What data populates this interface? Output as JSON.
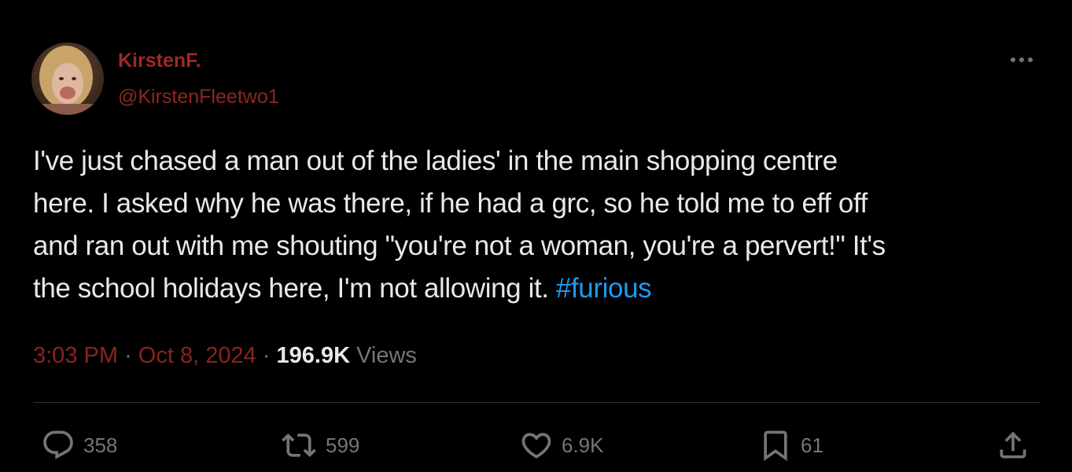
{
  "author": {
    "display_name": "KirstenF.",
    "handle": "@KirstenFleetwo1"
  },
  "tweet": {
    "lines": [
      "I've just chased a man out of the ladies' in the main shopping centre",
      "here. I asked why he was there, if he had a grc, so he told me to eff off",
      "and ran out with me shouting \"you're not a woman, you're a pervert!\" It's",
      "the school holidays here, I'm not allowing it. "
    ],
    "hashtag": "#furious"
  },
  "meta": {
    "time": "3:03 PM",
    "date": "Oct 8, 2024",
    "separator": "·",
    "views_count": "196.9K",
    "views_label": "Views"
  },
  "actions": {
    "replies": "358",
    "reposts": "599",
    "likes": "6.9K",
    "bookmarks": "61"
  },
  "icons": {
    "more": "more-horizontal-icon",
    "reply": "reply-icon",
    "repost": "repost-icon",
    "like": "heart-icon",
    "bookmark": "bookmark-icon",
    "share": "share-icon"
  },
  "colors": {
    "background": "#000000",
    "text": "#e7e9ea",
    "muted": "#71767b",
    "link": "#1d9bf0",
    "name": "#9e2a24"
  }
}
